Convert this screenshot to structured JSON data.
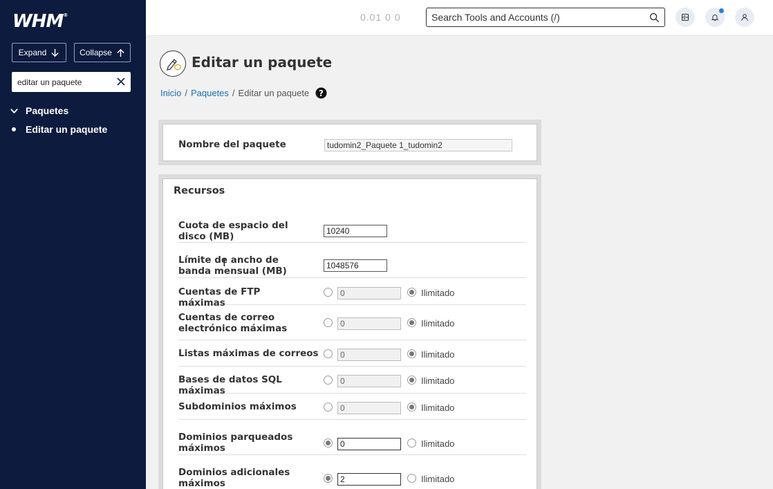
{
  "sidebar": {
    "logo": "WHM",
    "expand_label": "Expand",
    "collapse_label": "Collapse",
    "filter_value": "editar un paquete",
    "group_label": "Paquetes",
    "active_item": "Editar un paquete"
  },
  "topbar": {
    "load_avg": "0.01  0  0",
    "search_placeholder": "Search Tools and Accounts (/)"
  },
  "page": {
    "title": "Editar un paquete",
    "breadcrumb": [
      "Inicio",
      "Paquetes",
      "Editar un paquete"
    ]
  },
  "package": {
    "name_label": "Nombre del paquete",
    "name_value": "tudomin2_Paquete 1_tudomin2"
  },
  "resources": {
    "title": "Recursos",
    "disk_label": "Cuota de espacio del disco (MB)",
    "disk_value": "10240",
    "bw_label": "Límite de ancho de banda mensual (MB)",
    "bw_value": "1048576",
    "unlimited_label": "Ilimitado",
    "rows": [
      {
        "label": "Cuentas de FTP máximas",
        "value": "0",
        "unlimited": true
      },
      {
        "label": "Cuentas de correo electrónico máximas",
        "value": "0",
        "unlimited": true
      },
      {
        "label": "Listas máximas de correos",
        "value": "0",
        "unlimited": true
      },
      {
        "label": "Bases de datos SQL máximas",
        "value": "0",
        "unlimited": true
      },
      {
        "label": "Subdominios máximos",
        "value": "0",
        "unlimited": true
      },
      {
        "label": "Dominios parqueados máximos",
        "value": "0",
        "unlimited": false
      },
      {
        "label": "Dominios adicionales máximos",
        "value": "2",
        "unlimited": false
      }
    ]
  }
}
